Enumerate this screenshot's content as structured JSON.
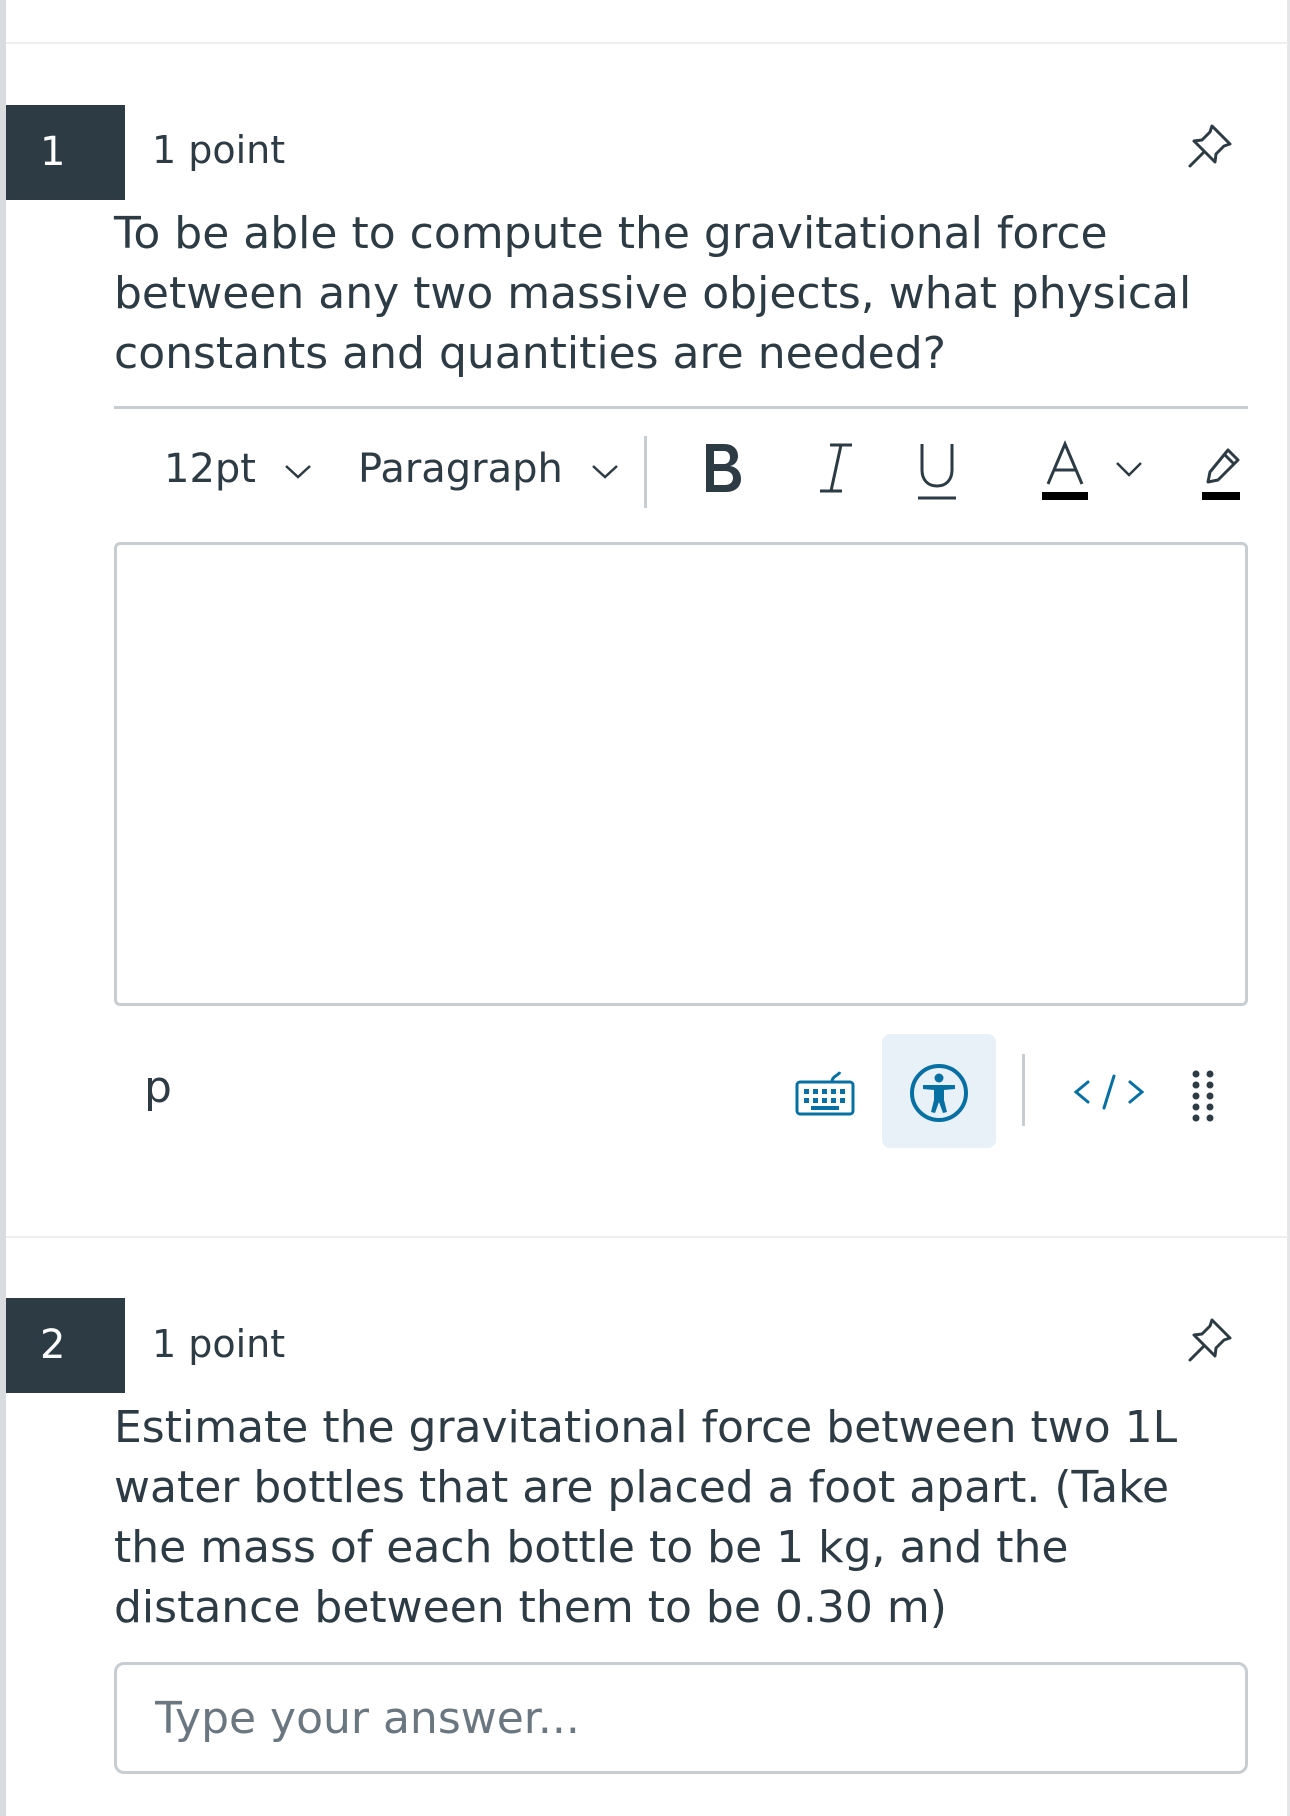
{
  "questions": [
    {
      "number": "1",
      "points": "1 point",
      "text": "To be able to compute the gravitational force between any two massive objects, what physical constants and quantities are needed?",
      "editor": {
        "font_size": "12pt",
        "block_format": "Paragraph",
        "status_path": "p"
      }
    },
    {
      "number": "2",
      "points": "1 point",
      "text": "Estimate the gravitational force between two 1L water bottles that are placed a foot apart. (Take the mass of each bottle to be 1 kg, and the distance between them to be 0.30 m)",
      "answer_placeholder": "Type your answer..."
    }
  ],
  "colors": {
    "number_badge_bg": "#2d3b45",
    "text": "#2d3b45",
    "link_blue": "#0770a3",
    "a11y_highlight": "#e8f1f8",
    "border": "#c7cdd1"
  },
  "icons": {
    "pin": "pin-icon",
    "bold": "bold-icon",
    "italic": "italic-icon",
    "underline": "underline-icon",
    "text_color": "text-color-icon",
    "highlight": "highlight-color-icon",
    "keyboard": "keyboard-icon",
    "accessibility": "accessibility-icon",
    "html_editor": "html-editor-icon",
    "drag_handle": "drag-handle-icon"
  }
}
